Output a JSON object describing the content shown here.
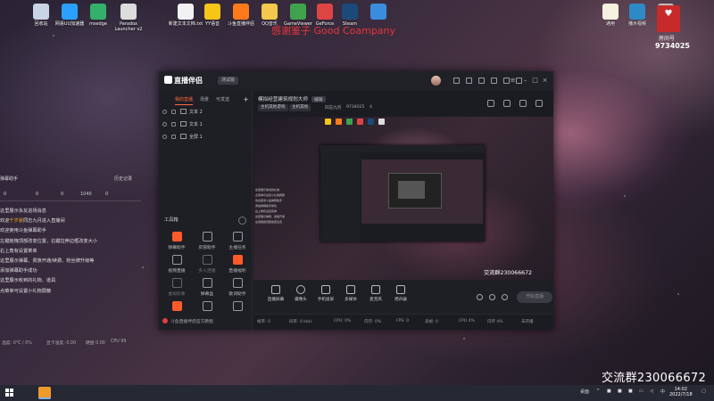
{
  "desktop": {
    "icons": [
      {
        "label": "回收站",
        "color": "#c9d4e6"
      },
      {
        "label": "网易UU加速器",
        "color": "#2aa1ff"
      },
      {
        "label": "msedge",
        "color": "#35b06a"
      },
      {
        "label": "Paradox Launcher v2",
        "color": "#dcdcdc"
      },
      {
        "label": "新建文本文档.txt",
        "color": "#f2f2f2"
      },
      {
        "label": "YY语音",
        "color": "#f5c518"
      },
      {
        "label": "斗鱼直播伴侣",
        "color": "#ff7a1a"
      },
      {
        "label": "QQ音乐",
        "color": "#f2c94c"
      },
      {
        "label": "GameViewer",
        "color": "#3fa34d"
      },
      {
        "label": "GeForce",
        "color": "#d44"
      },
      {
        "label": "Steam",
        "color": "#1b4a7a"
      },
      {
        "label": "",
        "color": "#3a8dde"
      },
      {
        "label": "通用",
        "color": "#f5f0e0"
      },
      {
        "label": "播示视频",
        "color": "#2e8ac7"
      },
      {
        "label": "",
        "color": "#c0c0c0"
      }
    ],
    "overlay_text": "感谢鉴子 Good Coampany",
    "room_badge_label": "房间号",
    "room_number": "9734025",
    "qq_group_text": "交流群230066672"
  },
  "chat_panel": {
    "title": "弹幕助手",
    "record_label": "历史记录",
    "stats": [
      "0",
      "0",
      "0",
      "1040",
      "0"
    ],
    "lines": [
      {
        "text": "这里展示永友进场消息"
      },
      {
        "prefix": "欢迎",
        "name": "千岁晨",
        "suffix": "同志九月进入直播间"
      },
      {
        "text": "欢迎使用斗鱼弹幕助手"
      },
      {
        "text": "左键拖拽顶部改变位置，右键拉伸边框改变大小"
      },
      {
        "text": "右上角有设置菜单"
      },
      {
        "text": "这里展示弹幕、贵族开通/续费、粉丝牌升级等"
      },
      {
        "text": "添加弹幕助手成功"
      },
      {
        "text": "这里展示收到的礼物、道具"
      },
      {
        "text": "点菜单可设置小礼物屏蔽"
      }
    ],
    "footer": [
      "温度: 0°C / 0%",
      "显卡温度: 0.00",
      "硬盘 0.00",
      "CPU 99"
    ]
  },
  "app": {
    "logo": "直播伴侣",
    "version": "测试版",
    "scene_tabs": [
      "我的直播",
      "场景",
      "可发送"
    ],
    "sources": [
      "文本 2",
      "文本 1",
      "全屏 1"
    ],
    "tools_title": "工具箱",
    "tools": [
      {
        "label": "弹幕助手",
        "state": "hot"
      },
      {
        "label": "房管助手",
        "state": "normal"
      },
      {
        "label": "主播任务",
        "state": "normal"
      },
      {
        "label": "视频直播",
        "state": "normal"
      },
      {
        "label": "多人连播",
        "state": "dim"
      },
      {
        "label": "直播福利",
        "state": "hot"
      },
      {
        "label": "虚拟形象",
        "state": "dim"
      },
      {
        "label": "弹幕盒",
        "state": "normal"
      },
      {
        "label": "歌词助手",
        "state": "normal"
      },
      {
        "label": "",
        "state": "hot"
      },
      {
        "label": "",
        "state": "normal"
      },
      {
        "label": "",
        "state": "normal"
      }
    ],
    "sidebar_footer": "斗鱼直播伴侣官方教程",
    "room_title": "模拟经营建筑规划大师",
    "edit_label": "编辑",
    "categories": [
      "主机其他游戏",
      "主机其他"
    ],
    "room_meta": [
      "同志九月",
      "9734025",
      "4"
    ],
    "header_icons": [
      "分享",
      "设置",
      "礼物",
      "通知",
      "分享"
    ],
    "preview_chat": [
      "这里展示收到的礼物",
      "点菜单可设置小礼物屏蔽",
      "欢迎使用斗鱼弹幕助手",
      "添加弹幕助手成功",
      "右上角有设置菜单",
      "这里展示弹幕、贵族开通",
      "左键拖拽顶部改变位置"
    ],
    "preview_qq": "交流群230066672",
    "controls": [
      "直播屏幕",
      "摄像头",
      "手机投屏",
      "多媒体",
      "麦克风",
      "扬声器"
    ],
    "start_label": "开始直播",
    "status": [
      "帧率: 0",
      "码率: 0 kb/s",
      "CPU: 0%",
      "内存: 0%",
      "FPS: 0",
      "丢帧: 0",
      "CPU 4%",
      "内存 4%",
      "未开播"
    ]
  },
  "taskbar": {
    "tray": [
      "桌面"
    ],
    "time": "14:02",
    "date": "2022/7/18"
  }
}
